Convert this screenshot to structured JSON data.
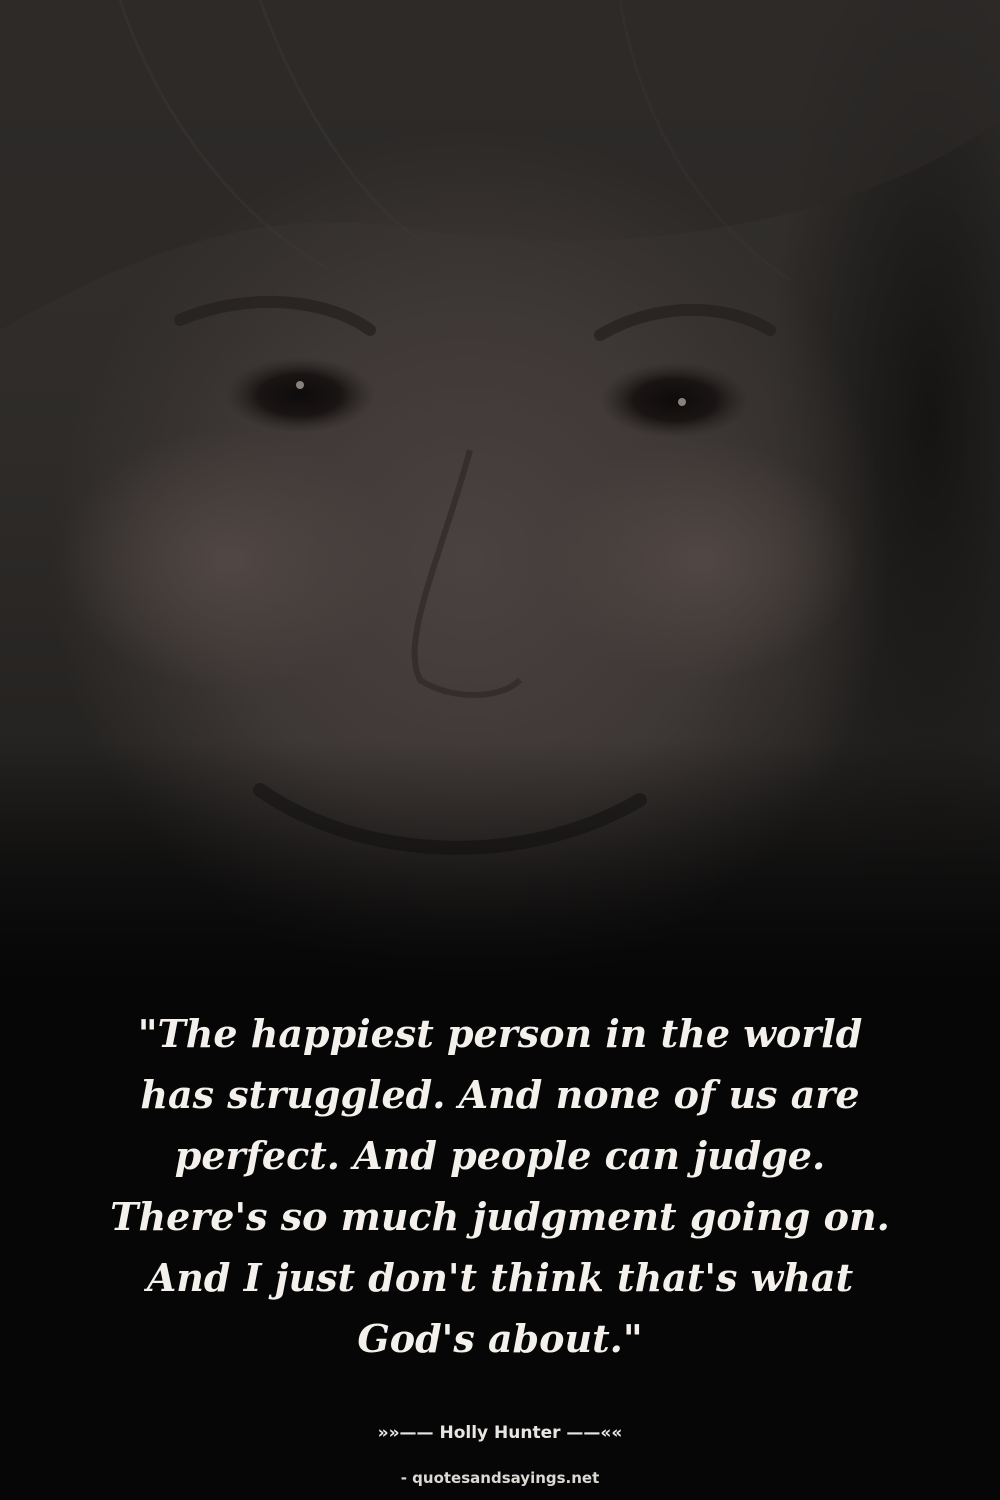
{
  "quote": {
    "text": "\"The happiest person in the world has struggled. And none of us are perfect. And people can judge. There's so much judgment going on. And I just don't think that's what God's about.\""
  },
  "attribution": {
    "author_line": "»»—— Holly Hunter ——««"
  },
  "source": {
    "label": "- quotesandsayings.net"
  },
  "colors": {
    "background": "#060606",
    "quote_text": "#f4f1ec",
    "author_text": "#e9e6e2"
  }
}
